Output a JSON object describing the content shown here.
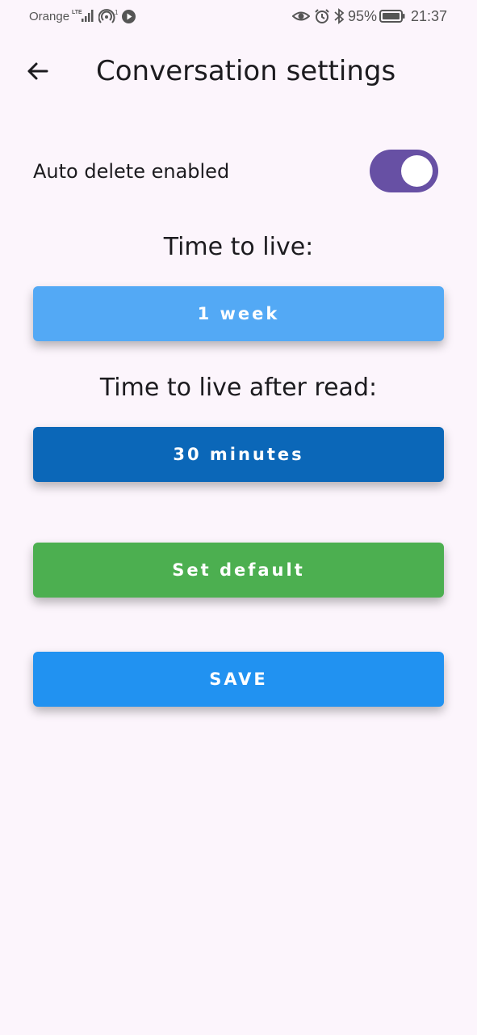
{
  "status_bar": {
    "carrier": "Orange",
    "network": "LTE",
    "hotspot_count": "1",
    "battery_pct": "95%",
    "time": "21:37"
  },
  "app_bar": {
    "title": "Conversation settings",
    "back_icon": "arrow-back-icon"
  },
  "settings": {
    "auto_delete_label": "Auto delete enabled",
    "auto_delete_enabled": true,
    "ttl_heading": "Time to live:",
    "ttl_value": "1 week",
    "ttl_after_read_heading": "Time to live after read:",
    "ttl_after_read_value": "30 minutes",
    "set_default_label": "Set default",
    "save_label": "SAVE"
  },
  "colors": {
    "background": "#fcf5fc",
    "toggle_on": "#6750a4",
    "ttl_button": "#53a9f5",
    "ttl_after_read_button": "#0b67b8",
    "set_default_button": "#4caf50",
    "save_button": "#2192f1"
  }
}
